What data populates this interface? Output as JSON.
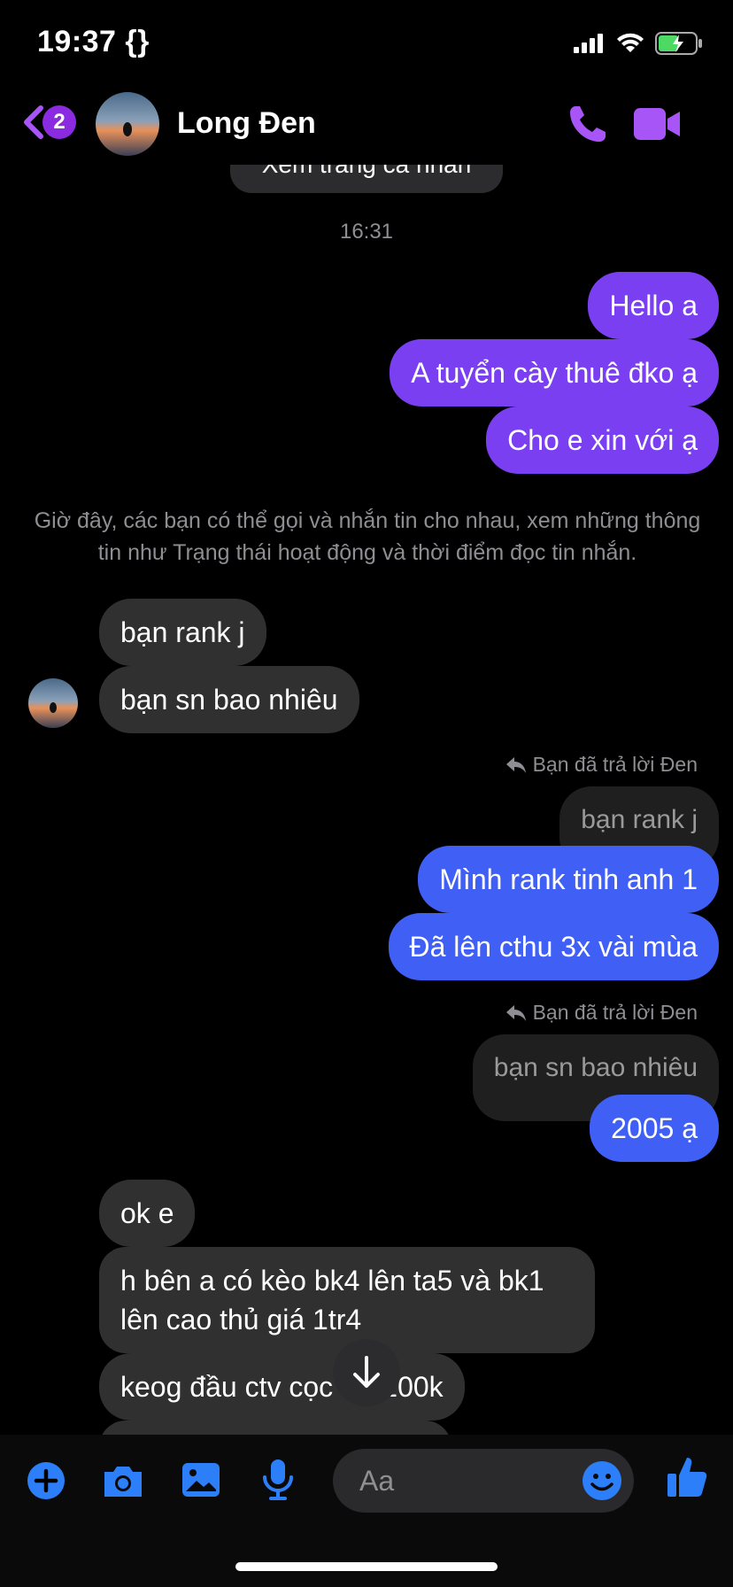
{
  "status": {
    "time": "19:37 {}"
  },
  "header": {
    "unread_count": "2",
    "contact_name": "Long Đen"
  },
  "profile_link": "Xem trang cá nhân",
  "timestamp": "16:31",
  "outgoing_first": [
    "Hello a",
    "A tuyển cày thuê đko ạ",
    "Cho e xin với ạ"
  ],
  "notice": "Giờ đây, các bạn có thể gọi và nhắn tin cho nhau, xem những thông tin như Trạng thái hoạt động và thời điểm đọc tin nhắn.",
  "incoming_first": [
    "bạn rank j",
    "bạn sn bao nhiêu"
  ],
  "reply1": {
    "label": "Bạn đã trả lời Đen",
    "quoted": "bạn rank j",
    "messages": [
      "Mình rank tinh anh 1",
      "Đã lên cthu 3x vài mùa"
    ]
  },
  "reply2": {
    "label": "Bạn đã trả lời Đen",
    "quoted": "bạn sn bao nhiêu",
    "messages": [
      "2005 ạ"
    ]
  },
  "incoming_second": [
    "ok e",
    "h bên a có kèo bk4 lên ta5 và bk1 lên cao thủ giá 1tr4",
    "keog đầu ctv cọc 50-100k"
  ],
  "composer": {
    "placeholder": "Aa"
  },
  "colors": {
    "accent": "#a855f7",
    "blue": "#3f5ff5",
    "purple": "#7b3ff2",
    "composer_icons": "#2d7ff9"
  },
  "icons": [
    "back-chevron-icon",
    "phone-icon",
    "video-icon",
    "plus-icon",
    "camera-icon",
    "photo-icon",
    "microphone-icon",
    "emoji-icon",
    "like-icon",
    "arrow-down-icon",
    "reply-icon"
  ]
}
